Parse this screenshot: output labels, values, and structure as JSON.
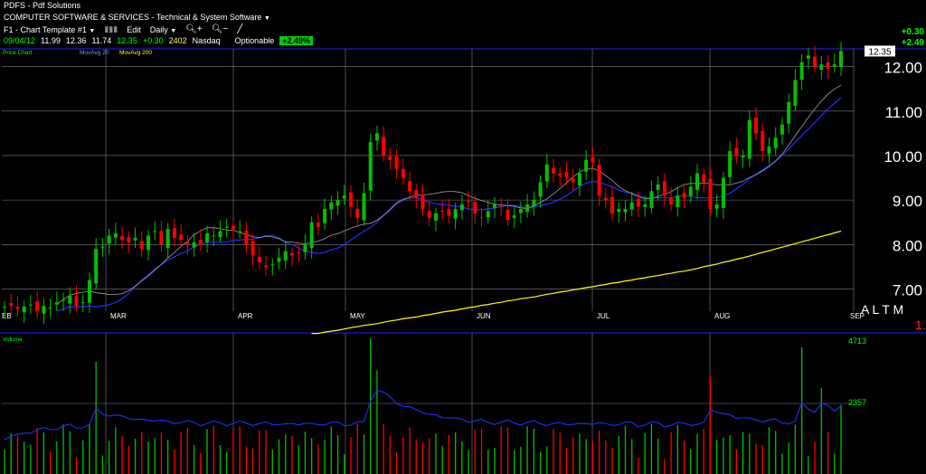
{
  "header": {
    "symbol_line": "PDFS - Pdf Solutions",
    "industry": "COMPUTER SOFTWARE & SERVICES - Technical & System Software",
    "template": "F1 - Chart Template #1",
    "edit": "Edit",
    "interval": "Daily",
    "date": "09/04/12",
    "open": "11.99",
    "high": "12.36",
    "low": "11.74",
    "close": "12.35",
    "change": "+0.30",
    "volume": "2402",
    "exchange": "Nasdaq",
    "optionable": "Optionable",
    "pct_change": "+2.49%",
    "right_change": "+0.30",
    "right_pct": "+2.49"
  },
  "price_panel": {
    "legend_price": "Price Chart",
    "legend_ma20": "MovAvg 20",
    "legend_ma200": "MovAvg 200",
    "last_price_label": "12.35",
    "right_codes": "A L T M",
    "right_red": "1.",
    "y_ticks": [
      "12.00",
      "11.00",
      "10.00",
      "9.00",
      "8.00",
      "7.00"
    ],
    "x_ticks": [
      "EB",
      "MAR",
      "APR",
      "MAY",
      "JUN",
      "JUL",
      "AUG",
      "SEP"
    ]
  },
  "volume_panel": {
    "legend": "Volume",
    "legend_avg": "",
    "y_ticks": [
      "4713",
      "2357"
    ]
  },
  "colors": {
    "up": "#00c000",
    "down": "#ff0000",
    "ma20": "#a0a0a0",
    "ma200": "#ffff00",
    "vol_avg": "#2030ff",
    "grid": "#808080",
    "frame": "#2020ff"
  },
  "chart_data": {
    "type": "candlestick",
    "symbol": "PDFS",
    "ylim": [
      6.5,
      12.4
    ],
    "x_months": [
      "Feb",
      "Mar",
      "Apr",
      "May",
      "Jun",
      "Jul",
      "Aug",
      "Sep"
    ],
    "close": [
      6.6,
      6.62,
      6.55,
      6.6,
      6.65,
      6.5,
      6.62,
      6.58,
      6.7,
      6.75,
      6.85,
      6.62,
      6.7,
      7.2,
      7.9,
      7.95,
      8.2,
      8.25,
      8.1,
      8.05,
      8.15,
      7.9,
      8.2,
      8.3,
      8.0,
      8.35,
      8.15,
      8.1,
      8.0,
      8.05,
      8.0,
      8.25,
      8.2,
      8.3,
      8.4,
      8.35,
      8.3,
      8.0,
      7.75,
      7.6,
      7.5,
      7.55,
      7.7,
      7.85,
      7.75,
      7.8,
      8.0,
      8.5,
      8.4,
      8.8,
      8.95,
      9.0,
      9.1,
      8.85,
      8.6,
      9.15,
      10.3,
      10.5,
      10.0,
      9.9,
      9.7,
      9.5,
      9.2,
      9.05,
      8.8,
      8.6,
      8.7,
      8.75,
      8.65,
      8.8,
      8.9,
      8.95,
      8.7,
      8.6,
      8.75,
      8.9,
      8.85,
      8.55,
      8.65,
      8.8,
      8.9,
      9.0,
      9.4,
      9.8,
      9.6,
      9.55,
      9.5,
      9.4,
      9.6,
      9.9,
      9.85,
      9.1,
      9.0,
      8.7,
      8.8,
      8.8,
      8.95,
      8.85,
      8.9,
      9.2,
      9.35,
      9.1,
      8.9,
      9.1,
      9.05,
      9.3,
      9.6,
      9.4,
      8.8,
      8.9,
      9.5,
      10.1,
      10.0,
      10.0,
      10.8,
      10.5,
      10.1,
      10.2,
      10.4,
      10.7,
      11.2,
      11.7,
      12.1,
      12.25,
      12.0,
      12.05,
      11.95,
      12.05,
      12.35
    ],
    "ma20": [
      6.5,
      6.55,
      6.6,
      6.6,
      6.6,
      6.62,
      6.6,
      6.62,
      6.64,
      6.7,
      6.78,
      6.9,
      7.05,
      7.2,
      7.32,
      7.45,
      7.55,
      7.65,
      7.72,
      7.8,
      7.85,
      7.95,
      8.0,
      8.05,
      8.05,
      8.05,
      8.05,
      8.1,
      8.1,
      8.12,
      8.12,
      8.15,
      8.2,
      8.2,
      8.15,
      8.05,
      8.0,
      7.92,
      7.85,
      7.82,
      7.8,
      7.82,
      7.88,
      7.92,
      8.0,
      8.1,
      8.2,
      8.3,
      8.38,
      8.5,
      8.65,
      8.8,
      8.95,
      9.02,
      9.05,
      9.05,
      9.0,
      8.95,
      8.92,
      8.9,
      8.88,
      8.86,
      8.84,
      8.8,
      8.78,
      8.78,
      8.8,
      8.82,
      8.85,
      8.88,
      8.88,
      8.85,
      8.82,
      8.85,
      8.88,
      8.9,
      8.95,
      9.02,
      9.1,
      9.2,
      9.3,
      9.38,
      9.42,
      9.4,
      9.35,
      9.3,
      9.22,
      9.18,
      9.15,
      9.1,
      9.05,
      9.05,
      9.05,
      9.05,
      9.05,
      9.08,
      9.1,
      9.08,
      9.05,
      9.05,
      9.05,
      9.05,
      9.1,
      9.15,
      9.25,
      9.35,
      9.48,
      9.58,
      9.68,
      9.78,
      9.88,
      10.0,
      10.15,
      10.3,
      10.45,
      10.6,
      10.75,
      10.9,
      11.05,
      11.18,
      11.3
    ],
    "ma200": [
      6.0,
      6.0,
      6.03,
      6.05,
      6.07,
      6.1,
      6.13,
      6.15,
      6.18,
      6.2,
      6.22,
      6.25,
      6.28,
      6.3,
      6.33,
      6.35,
      6.37,
      6.4,
      6.42,
      6.45,
      6.48,
      6.5,
      6.52,
      6.55,
      6.58,
      6.6,
      6.63,
      6.65,
      6.68,
      6.7,
      6.73,
      6.75,
      6.78,
      6.8,
      6.82,
      6.85,
      6.88,
      6.9,
      6.93,
      6.95,
      6.98,
      7.0,
      7.03,
      7.05,
      7.08,
      7.1,
      7.13,
      7.15,
      7.18,
      7.2,
      7.23,
      7.25,
      7.28,
      7.3,
      7.33,
      7.35,
      7.38,
      7.4,
      7.43,
      7.46,
      7.5,
      7.53,
      7.56,
      7.6,
      7.63,
      7.67,
      7.7,
      7.74,
      7.78,
      7.82,
      7.86,
      7.9,
      7.94,
      7.98,
      8.02,
      8.06,
      8.1,
      8.14,
      8.18,
      8.22,
      8.26,
      8.3
    ],
    "volume_max": 4713
  }
}
